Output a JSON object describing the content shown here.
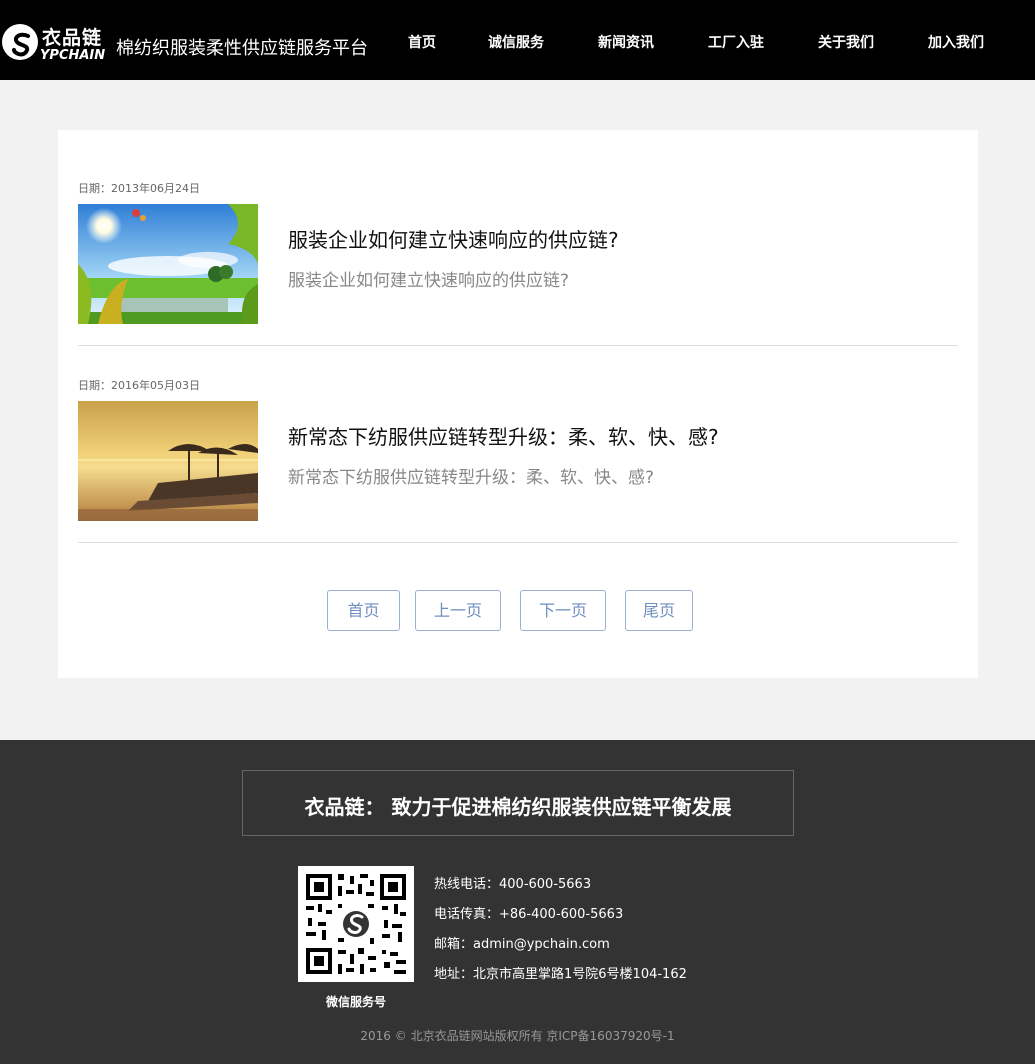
{
  "header": {
    "logo_cn": "衣品链",
    "logo_en": "YPCHAIN",
    "site_title": "棉纺织服装柔性供应链服务平台",
    "nav": [
      "首页",
      "诚信服务",
      "新闻资讯",
      "工厂入驻",
      "关于我们",
      "加入我们"
    ]
  },
  "articles": [
    {
      "date": "日期：2013年06月24日",
      "title": "服装企业如何建立快速响应的供应链?",
      "summary": "服装企业如何建立快速响应的供应链?",
      "thumb_icon": "meadow-landscape-image"
    },
    {
      "date": "日期：2016年05月03日",
      "title": "新常态下纺服供应链转型升级：柔、软、快、感?",
      "summary": "新常态下纺服供应链转型升级：柔、软、快、感?",
      "thumb_icon": "beach-sunset-image"
    }
  ],
  "pager": {
    "first": "首页",
    "prev": "上一页",
    "next": "下一页",
    "last": "尾页"
  },
  "footer": {
    "slogan": "衣品链： 致力于促进棉纺织服装供应链平衡发展",
    "qr_label": "微信服务号",
    "contacts": [
      "热线电话：400-600-5663",
      "电话传真：+86-400-600-5663",
      "邮箱：admin@ypchain.com",
      "地址：北京市高里掌路1号院6号楼104-162"
    ],
    "copyright": "2016 © 北京衣品链网站版权所有 京ICP备16037920号-1"
  },
  "colors": {
    "header_bg": "#000000",
    "footer_bg": "#333333",
    "pager_accent": "#6f8fbf",
    "page_bg": "#f2f2f2"
  }
}
